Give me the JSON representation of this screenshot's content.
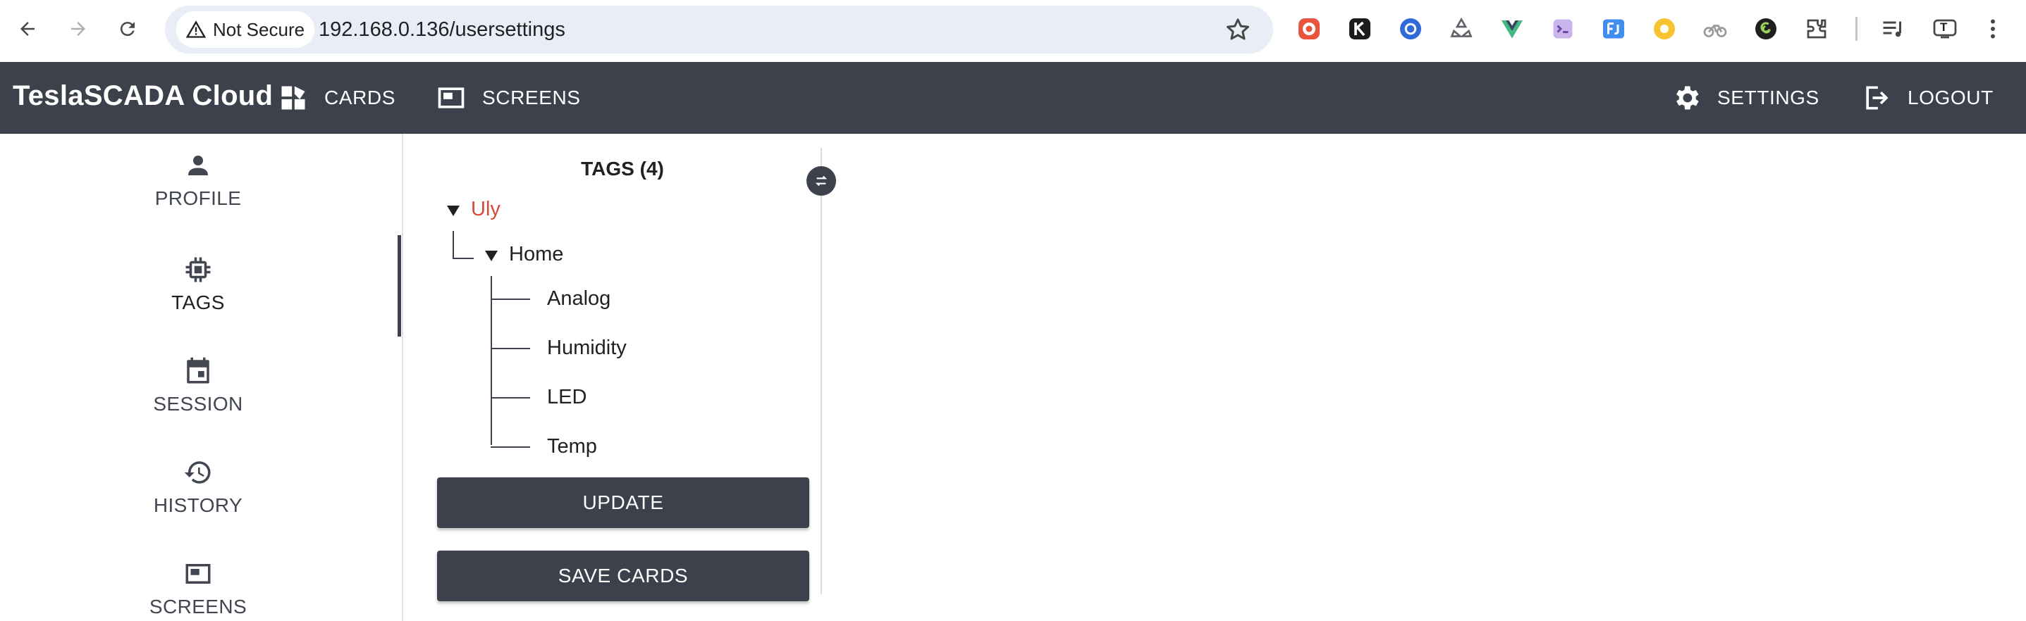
{
  "browser": {
    "security_label": "Not Secure",
    "url": "192.168.0.136/usersettings",
    "extensions": [
      "recorder-extension-icon",
      "k-extension-icon",
      "iq-extension-icon",
      "recycle-extension-icon",
      "vue-devtools-icon",
      "vim-extension-icon",
      "fj-extension-icon",
      "yellow-circle-extension-icon",
      "cycling-extension-icon",
      "six-extension-icon",
      "puzzle-extensions-icon"
    ],
    "profile_label": "T"
  },
  "app": {
    "brand": "TeslaSCADA Cloud",
    "nav": {
      "cards": "CARDS",
      "screens": "SCREENS",
      "settings": "SETTINGS",
      "logout": "LOGOUT"
    }
  },
  "sidebar": {
    "active": "TAGS",
    "items": [
      {
        "label": "PROFILE",
        "icon": "person-icon"
      },
      {
        "label": "TAGS",
        "icon": "chip-icon"
      },
      {
        "label": "SESSION",
        "icon": "calendar-icon"
      },
      {
        "label": "HISTORY",
        "icon": "history-icon"
      },
      {
        "label": "SCREENS",
        "icon": "screen-icon"
      }
    ]
  },
  "tags_panel": {
    "title": "TAGS (4)",
    "tree": {
      "root": "Uly",
      "group": "Home",
      "leaves": [
        "Analog",
        "Humidity",
        "LED",
        "Temp"
      ]
    },
    "buttons": {
      "update": "UPDATE",
      "save_cards": "SAVE CARDS"
    }
  },
  "colors": {
    "appbar": "#3c414b",
    "root_tag": "#d34d3f",
    "omnibox": "#e9eef6"
  }
}
